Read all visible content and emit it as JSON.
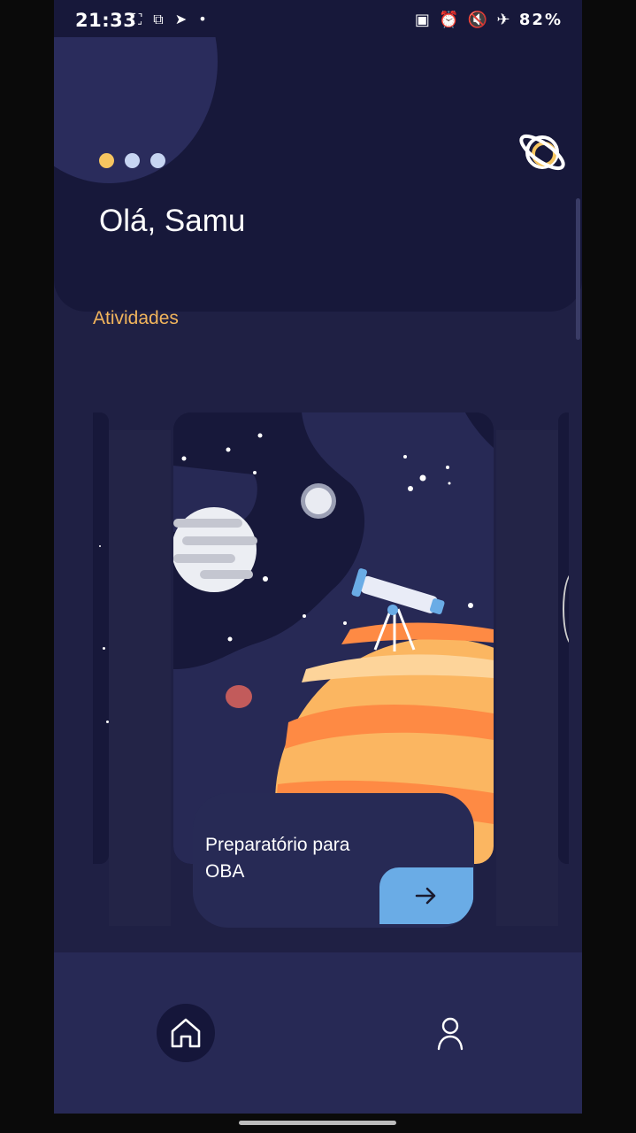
{
  "status_bar": {
    "time": "21:33",
    "left_icons": "⛶ ⧉ ➤ •",
    "right_icons": "▣ ⏰ 🔇 ✈",
    "battery": "82%"
  },
  "header": {
    "greeting": "Olá, Samu",
    "pager_dots": [
      {
        "color": "#f6c560"
      },
      {
        "color": "#c7d5f2"
      },
      {
        "color": "#c7d5f2"
      }
    ],
    "logo_icon": "planet-icon"
  },
  "section": {
    "title": "Atividades"
  },
  "activity_card": {
    "label": "Preparatório para OBA",
    "illustration": "space-telescope-illustration",
    "action_icon": "arrow-right-icon"
  },
  "bottom_nav": {
    "items": [
      {
        "icon": "home-icon",
        "active": true
      },
      {
        "icon": "user-icon",
        "active": false
      }
    ]
  },
  "colors": {
    "background": "#1f2044",
    "header": "#17183a",
    "accent": "#f1b45c",
    "button": "#6aace6"
  }
}
